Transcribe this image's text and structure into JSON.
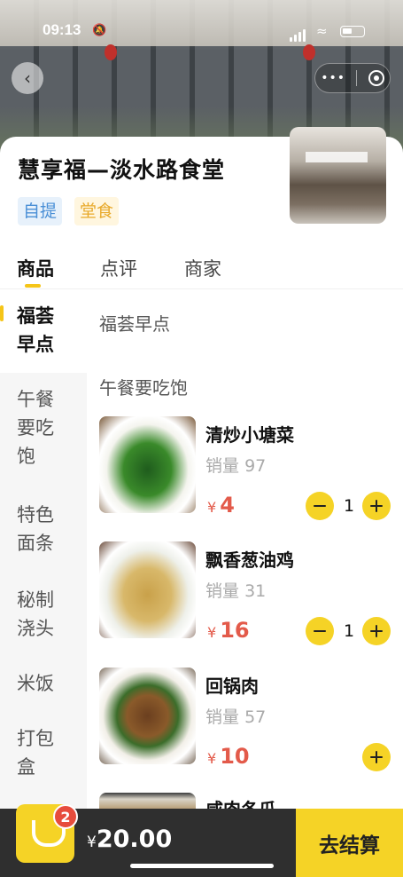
{
  "status_bar": {
    "time": "09:13"
  },
  "store": {
    "name": "慧享福—淡水路食堂",
    "tags": [
      "自提",
      "堂食"
    ]
  },
  "tabs": [
    "商品",
    "点评",
    "商家"
  ],
  "categories": [
    "福荟早点",
    "午餐要吃饱",
    "特色面条",
    "秘制浇头",
    "米饭",
    "打包盒"
  ],
  "sections": [
    "福荟早点",
    "午餐要吃饱"
  ],
  "items": [
    {
      "name": "清炒小塘菜",
      "sales_label": "销量",
      "sales": "97",
      "currency": "¥",
      "price": "4",
      "qty": "1"
    },
    {
      "name": "飘香葱油鸡",
      "sales_label": "销量",
      "sales": "31",
      "currency": "¥",
      "price": "16",
      "qty": "1"
    },
    {
      "name": "回锅肉",
      "sales_label": "销量",
      "sales": "57",
      "currency": "¥",
      "price": "10",
      "qty": ""
    },
    {
      "name": "咸肉冬瓜"
    }
  ],
  "cart": {
    "count": "2",
    "currency": "¥",
    "total": "20.00",
    "checkout_label": "去结算"
  },
  "colors": {
    "accent": "#f5d326",
    "price": "#e35a4a",
    "bottom_bar": "#2f2f2f"
  }
}
